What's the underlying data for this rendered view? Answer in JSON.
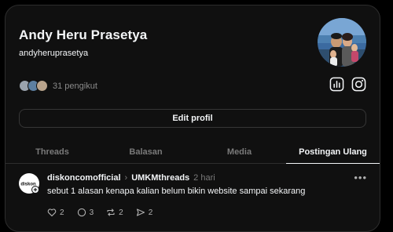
{
  "profile": {
    "display_name": "Andy Heru Prasetya",
    "handle": "andyheruprasetya",
    "followers_text": "31 pengikut",
    "avatar_icon": "profile-photo-icon"
  },
  "header_icons": [
    "insights-icon",
    "instagram-icon"
  ],
  "edit_button_label": "Edit profil",
  "tabs": [
    {
      "label": "Threads",
      "active": false
    },
    {
      "label": "Balasan",
      "active": false
    },
    {
      "label": "Media",
      "active": false
    },
    {
      "label": "Postingan Ulang",
      "active": true
    }
  ],
  "post": {
    "author": "diskoncomofficial",
    "community": "UMKMthreads",
    "time": "2 hari",
    "text": "sebut 1 alasan kenapa kalian belum bikin website sampai sekarang",
    "more": "•••",
    "avatar_label": "diskon",
    "actions": {
      "likes": "2",
      "comments": "3",
      "reposts": "2",
      "shares": "2"
    }
  },
  "colors": {
    "background": "#000000",
    "card": "#101010",
    "border": "#2d2d2d",
    "text_primary": "#f3f5f7",
    "text_secondary": "#7a7a7a"
  }
}
